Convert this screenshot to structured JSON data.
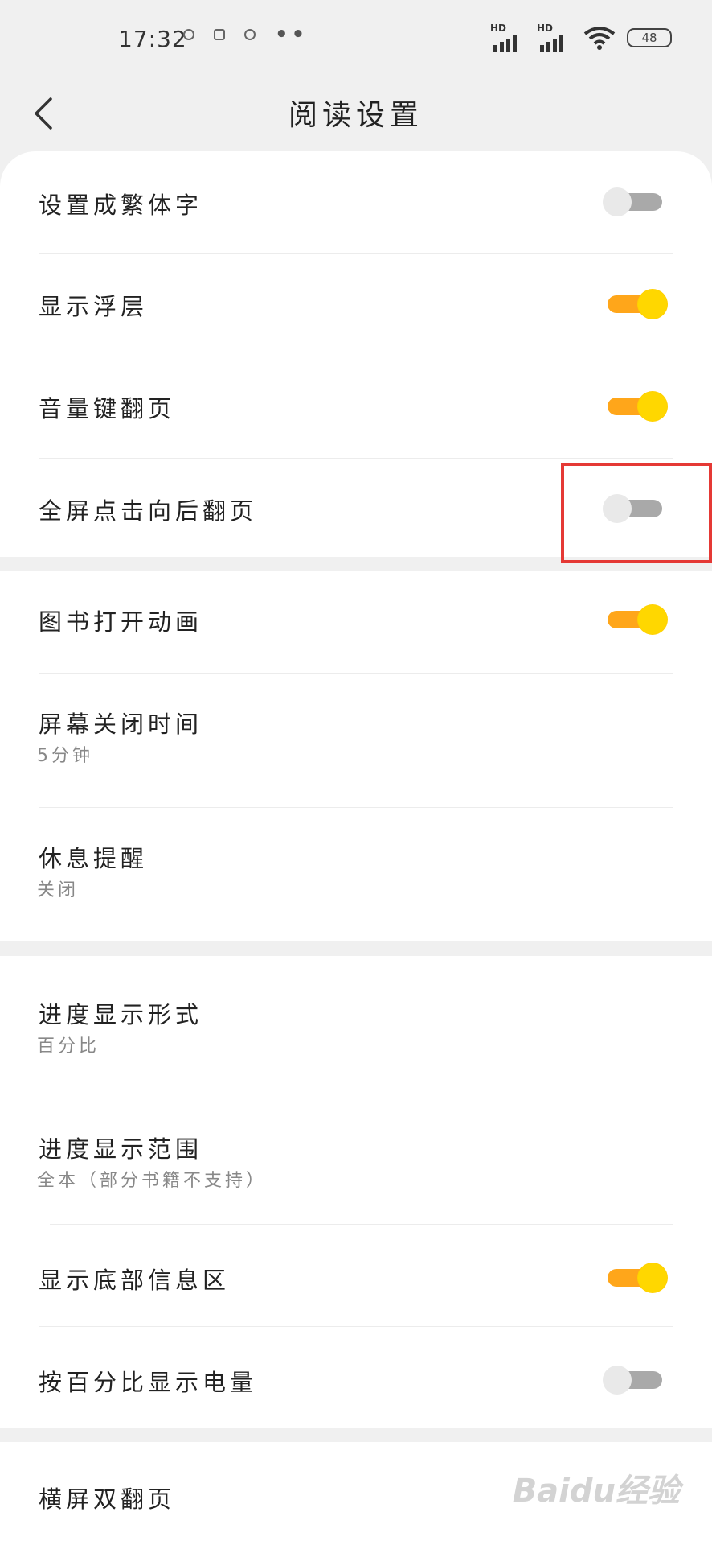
{
  "status_bar": {
    "time": "17:32",
    "network_label_1": "HD",
    "network_label_2": "HD",
    "battery": "48"
  },
  "header": {
    "title": "阅读设置"
  },
  "sections": [
    {
      "items": [
        {
          "label": "设置成繁体字",
          "toggle": false
        },
        {
          "label": "显示浮层",
          "toggle": true
        },
        {
          "label": "音量键翻页",
          "toggle": true
        },
        {
          "label": "全屏点击向后翻页",
          "toggle": false
        }
      ]
    },
    {
      "items": [
        {
          "label": "图书打开动画",
          "toggle": true
        },
        {
          "label": "屏幕关闭时间",
          "value": "5分钟"
        },
        {
          "label": "休息提醒",
          "value": "关闭"
        }
      ]
    },
    {
      "items": [
        {
          "label": "进度显示形式",
          "value": "百分比"
        },
        {
          "label": "进度显示范围",
          "value": "全本（部分书籍不支持）"
        },
        {
          "label": "显示底部信息区",
          "toggle": true
        },
        {
          "label": "按百分比显示电量",
          "toggle": false
        }
      ]
    },
    {
      "items": [
        {
          "label": "横屏双翻页"
        }
      ]
    }
  ],
  "watermark": "Baidu经验",
  "colors": {
    "toggle_on_track": "#ffa61a",
    "toggle_on_knob": "#ffd700",
    "toggle_off_track": "#a9a9a9",
    "highlight": "#e53935"
  }
}
